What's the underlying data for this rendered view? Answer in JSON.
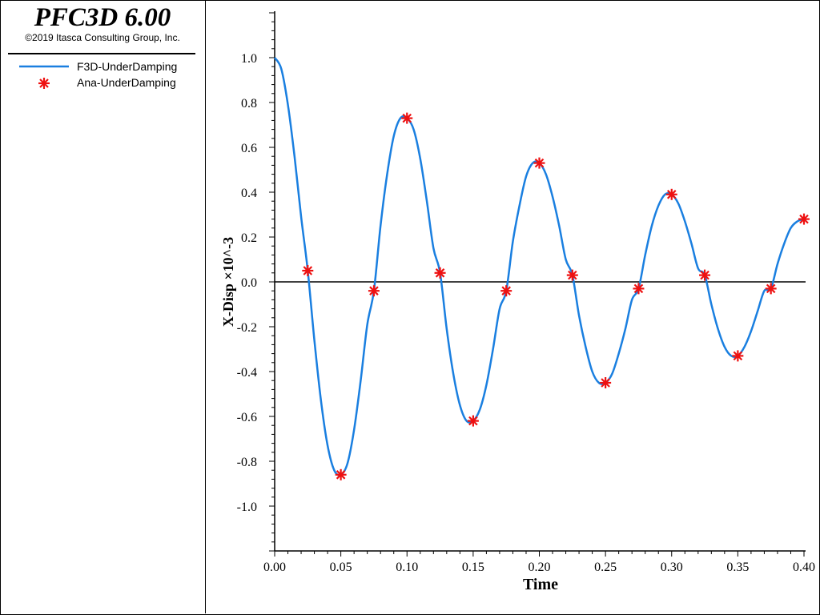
{
  "header": {
    "app_title": "PFC3D 6.00",
    "copyright": "©2019 Itasca Consulting Group, Inc."
  },
  "legend": [
    {
      "label": "F3D-UnderDamping",
      "symbol": "line",
      "color": "#1a7fe0"
    },
    {
      "label": "Ana-UnderDamping",
      "symbol": "asterisk",
      "color": "#ee1111"
    }
  ],
  "chart_data": {
    "type": "line",
    "xlabel": "Time",
    "ylabel": "X-Disp ×10^-3",
    "xlim": [
      0.0,
      0.4
    ],
    "ylim": [
      -1.2,
      1.2
    ],
    "x_ticks": [
      "0.00",
      "0.05",
      "0.10",
      "0.15",
      "0.20",
      "0.25",
      "0.30",
      "0.35",
      "0.40"
    ],
    "y_ticks": [
      "1.0",
      "0.8",
      "0.6",
      "0.4",
      "0.2",
      "0.0",
      "-0.2",
      "-0.4",
      "-0.6",
      "-0.8",
      "-1.0"
    ],
    "zero_line": true,
    "series": [
      {
        "name": "F3D-UnderDamping",
        "style": "line",
        "color": "#1a7fe0",
        "x": [
          0.0,
          0.005,
          0.01,
          0.015,
          0.02,
          0.025,
          0.03,
          0.035,
          0.04,
          0.045,
          0.05,
          0.055,
          0.06,
          0.065,
          0.07,
          0.075,
          0.08,
          0.085,
          0.09,
          0.095,
          0.1,
          0.105,
          0.11,
          0.115,
          0.12,
          0.125,
          0.13,
          0.135,
          0.14,
          0.145,
          0.15,
          0.155,
          0.16,
          0.165,
          0.17,
          0.175,
          0.18,
          0.185,
          0.19,
          0.195,
          0.2,
          0.205,
          0.21,
          0.215,
          0.22,
          0.225,
          0.23,
          0.235,
          0.24,
          0.245,
          0.25,
          0.255,
          0.26,
          0.265,
          0.27,
          0.275,
          0.28,
          0.285,
          0.29,
          0.295,
          0.3,
          0.305,
          0.31,
          0.315,
          0.32,
          0.325,
          0.33,
          0.335,
          0.34,
          0.345,
          0.35,
          0.355,
          0.36,
          0.365,
          0.37,
          0.375,
          0.38,
          0.385,
          0.39,
          0.395,
          0.4
        ],
        "y": [
          1.0,
          0.95,
          0.79,
          0.56,
          0.29,
          0.05,
          -0.26,
          -0.53,
          -0.73,
          -0.84,
          -0.86,
          -0.81,
          -0.66,
          -0.44,
          -0.19,
          -0.04,
          0.25,
          0.48,
          0.65,
          0.73,
          0.73,
          0.68,
          0.55,
          0.36,
          0.15,
          0.04,
          -0.21,
          -0.41,
          -0.55,
          -0.62,
          -0.62,
          -0.57,
          -0.46,
          -0.3,
          -0.12,
          -0.04,
          0.18,
          0.34,
          0.47,
          0.53,
          0.53,
          0.48,
          0.38,
          0.25,
          0.1,
          0.03,
          -0.15,
          -0.29,
          -0.4,
          -0.45,
          -0.45,
          -0.41,
          -0.32,
          -0.21,
          -0.08,
          -0.03,
          0.12,
          0.25,
          0.34,
          0.39,
          0.39,
          0.35,
          0.27,
          0.17,
          0.06,
          0.03,
          -0.1,
          -0.21,
          -0.29,
          -0.33,
          -0.33,
          -0.29,
          -0.22,
          -0.13,
          -0.04,
          -0.03,
          0.08,
          0.17,
          0.24,
          0.27,
          0.28
        ]
      },
      {
        "name": "Ana-UnderDamping",
        "style": "asterisk",
        "color": "#ee1111",
        "x": [
          0.025,
          0.05,
          0.075,
          0.1,
          0.125,
          0.15,
          0.175,
          0.2,
          0.225,
          0.25,
          0.275,
          0.3,
          0.325,
          0.35,
          0.375,
          0.4
        ],
        "y": [
          0.05,
          -0.86,
          -0.04,
          0.73,
          0.04,
          -0.62,
          -0.04,
          0.53,
          0.03,
          -0.45,
          -0.03,
          0.39,
          0.03,
          -0.33,
          -0.03,
          0.28
        ]
      }
    ]
  }
}
